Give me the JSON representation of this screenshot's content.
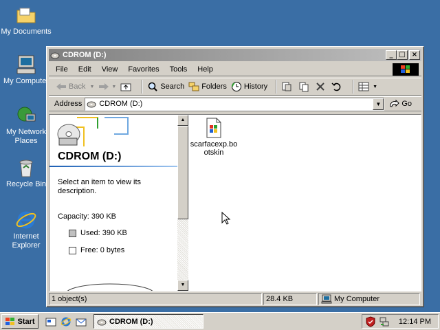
{
  "desktop": {
    "icons": [
      {
        "label": "My Documents",
        "icon": "folder-icon"
      },
      {
        "label": "My Computer",
        "icon": "computer-icon"
      },
      {
        "label": "My Network Places",
        "icon": "network-icon"
      },
      {
        "label": "Recycle Bin",
        "icon": "recycle-bin-icon"
      },
      {
        "label": "Internet Explorer",
        "icon": "ie-icon"
      }
    ]
  },
  "window": {
    "title": "CDROM (D:)",
    "menu": [
      "File",
      "Edit",
      "View",
      "Favorites",
      "Tools",
      "Help"
    ],
    "toolbar": {
      "back": "Back",
      "search": "Search",
      "folders": "Folders",
      "history": "History"
    },
    "address": {
      "label": "Address",
      "value": "CDROM (D:)",
      "go": "Go"
    },
    "left_pane": {
      "title": "CDROM (D:)",
      "description": "Select an item to view its description.",
      "capacity": "Capacity: 390 KB",
      "used": "Used: 390 KB",
      "free": "Free: 0 bytes"
    },
    "files": [
      {
        "name": "scarfacexp.bo otskin",
        "icon": "skin-file-icon"
      }
    ],
    "status": {
      "objects": "1 object(s)",
      "size": "28.4 KB",
      "zone": "My Computer"
    }
  },
  "taskbar": {
    "start": "Start",
    "task": "CDROM (D:)",
    "clock": "12:14 PM"
  },
  "colors": {
    "desktop": "#3a6ea5",
    "accent": "#1c5fb4"
  }
}
